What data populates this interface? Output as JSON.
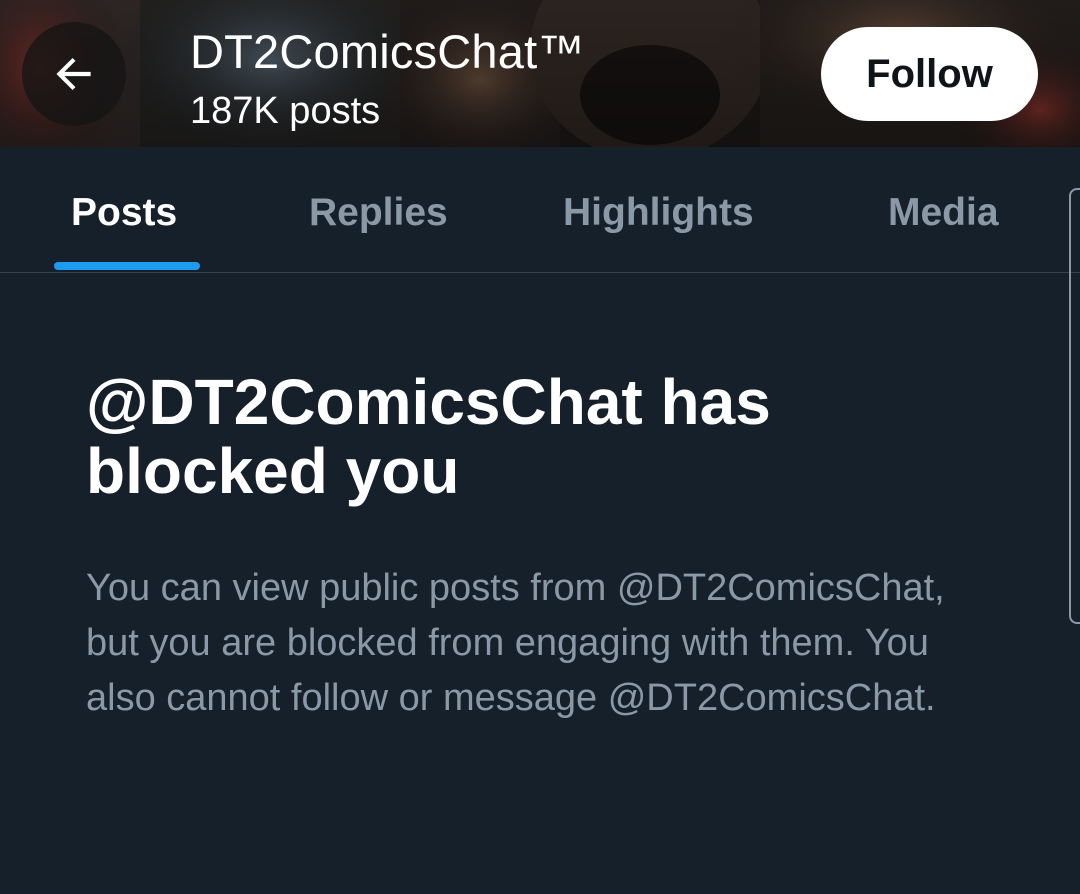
{
  "header": {
    "back_icon": "arrow-left-icon",
    "profile_name": "DT2ComicsChat™",
    "post_count": "187K posts",
    "follow_label": "Follow"
  },
  "tabs": [
    {
      "label": "Posts",
      "active": true
    },
    {
      "label": "Replies",
      "active": false
    },
    {
      "label": "Highlights",
      "active": false
    },
    {
      "label": "Media",
      "active": false
    }
  ],
  "blocked": {
    "title": "@DT2ComicsChat has blocked you",
    "body": "You can view public posts from @DT2ComicsChat, but you are blocked from engaging with them. You also cannot follow or message @DT2ComicsChat."
  },
  "colors": {
    "background": "#15202b",
    "accent": "#1d9bf0",
    "muted_text": "#8b98a5",
    "divider": "#38444d",
    "follow_button_bg": "#ffffff"
  }
}
